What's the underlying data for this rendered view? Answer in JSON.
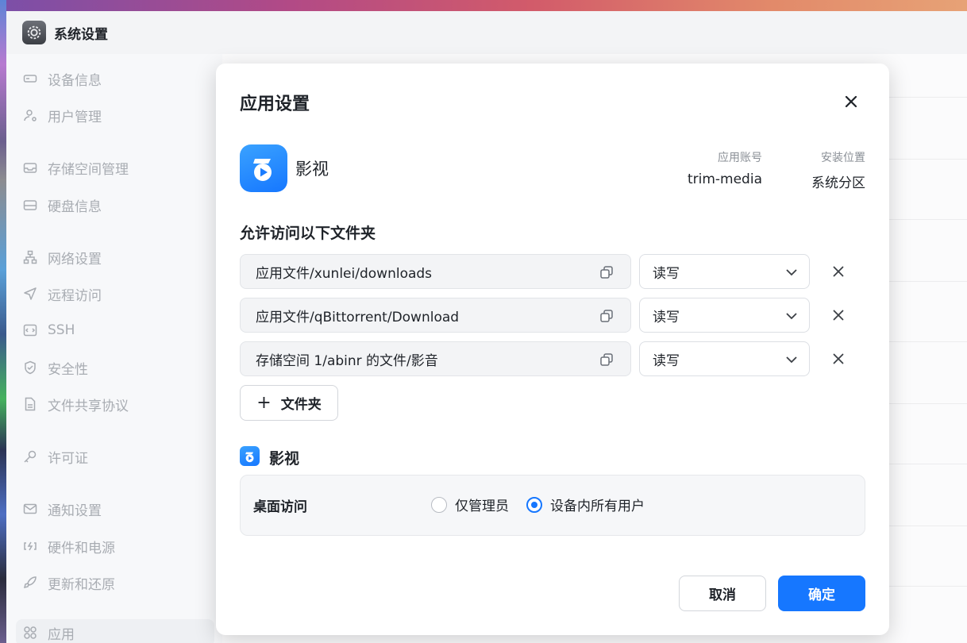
{
  "window": {
    "title": "系统设置"
  },
  "sidebar": {
    "items": [
      {
        "label": "设备信息",
        "icon": "drive-icon"
      },
      {
        "label": "用户管理",
        "icon": "user-icon"
      },
      {
        "label": "存储空间管理",
        "icon": "storage-icon"
      },
      {
        "label": "硬盘信息",
        "icon": "disk-icon"
      },
      {
        "label": "网络设置",
        "icon": "network-icon"
      },
      {
        "label": "远程访问",
        "icon": "send-icon"
      },
      {
        "label": "SSH",
        "icon": "ssh-icon"
      },
      {
        "label": "安全性",
        "icon": "shield-icon"
      },
      {
        "label": "文件共享协议",
        "icon": "file-icon"
      },
      {
        "label": "许可证",
        "icon": "key-icon"
      },
      {
        "label": "通知设置",
        "icon": "mail-icon"
      },
      {
        "label": "硬件和电源",
        "icon": "power-icon"
      },
      {
        "label": "更新和还原",
        "icon": "rocket-icon"
      },
      {
        "label": "应用",
        "icon": "apps-icon"
      }
    ]
  },
  "modal": {
    "title": "应用设置",
    "app": {
      "name": "影视",
      "account_label": "应用账号",
      "account_value": "trim-media",
      "location_label": "安装位置",
      "location_value": "系统分区"
    },
    "folders_title": "允许访问以下文件夹",
    "folders": [
      {
        "path": "应用文件/xunlei/downloads",
        "permission": "读写"
      },
      {
        "path": "应用文件/qBittorrent/Download",
        "permission": "读写"
      },
      {
        "path": "存储空间 1/abinr 的文件/影音",
        "permission": "读写"
      }
    ],
    "add_folder_label": "文件夹",
    "section_app_name": "影视",
    "desktop_access": {
      "label": "桌面访问",
      "options": [
        {
          "label": "仅管理员",
          "selected": false
        },
        {
          "label": "设备内所有用户",
          "selected": true
        }
      ]
    },
    "cancel_label": "取消",
    "ok_label": "确定"
  },
  "colors": {
    "accent": "#1677ff",
    "sidebar_text": "#a8acb2"
  }
}
